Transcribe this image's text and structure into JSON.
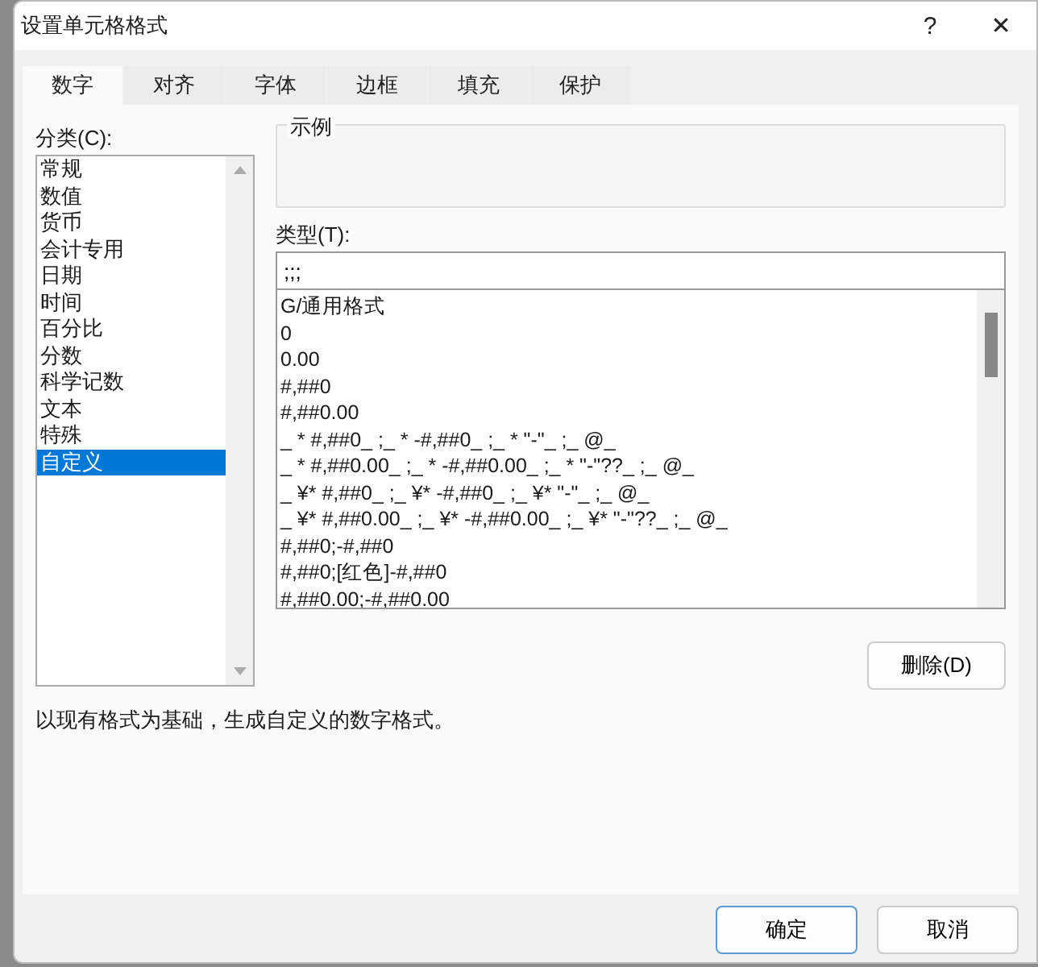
{
  "window": {
    "title": "设置单元格格式",
    "help": "?",
    "close": "✕"
  },
  "tabs": [
    {
      "label": "数字",
      "selected": true
    },
    {
      "label": "对齐",
      "selected": false
    },
    {
      "label": "字体",
      "selected": false
    },
    {
      "label": "边框",
      "selected": false
    },
    {
      "label": "填充",
      "selected": false
    },
    {
      "label": "保护",
      "selected": false
    }
  ],
  "category": {
    "label": "分类(C):",
    "items": [
      {
        "label": "常规",
        "selected": false
      },
      {
        "label": "数值",
        "selected": false
      },
      {
        "label": "货币",
        "selected": false
      },
      {
        "label": "会计专用",
        "selected": false
      },
      {
        "label": "日期",
        "selected": false
      },
      {
        "label": "时间",
        "selected": false
      },
      {
        "label": "百分比",
        "selected": false
      },
      {
        "label": "分数",
        "selected": false
      },
      {
        "label": "科学记数",
        "selected": false
      },
      {
        "label": "文本",
        "selected": false
      },
      {
        "label": "特殊",
        "selected": false
      },
      {
        "label": "自定义",
        "selected": true
      }
    ]
  },
  "sample": {
    "label": "示例"
  },
  "type": {
    "label": "类型(T):",
    "value": ";;;",
    "formats": [
      "G/通用格式",
      "0",
      "0.00",
      "#,##0",
      "#,##0.00",
      "_ * #,##0_ ;_ * -#,##0_ ;_ * \"-\"_ ;_ @_",
      "_ * #,##0.00_ ;_ * -#,##0.00_ ;_ * \"-\"??_ ;_ @_",
      "_ ¥* #,##0_ ;_ ¥* -#,##0_ ;_ ¥* \"-\"_ ;_ @_",
      "_ ¥* #,##0.00_ ;_ ¥* -#,##0.00_ ;_ ¥* \"-\"??_ ;_ @_",
      "#,##0;-#,##0",
      "#,##0;[红色]-#,##0",
      "#,##0.00;-#,##0.00"
    ]
  },
  "delete_button": "删除(D)",
  "description": "以现有格式为基础，生成自定义的数字格式。",
  "buttons": [
    {
      "label": "确定",
      "kind": "primary"
    },
    {
      "label": "取消",
      "kind": "normal"
    }
  ]
}
